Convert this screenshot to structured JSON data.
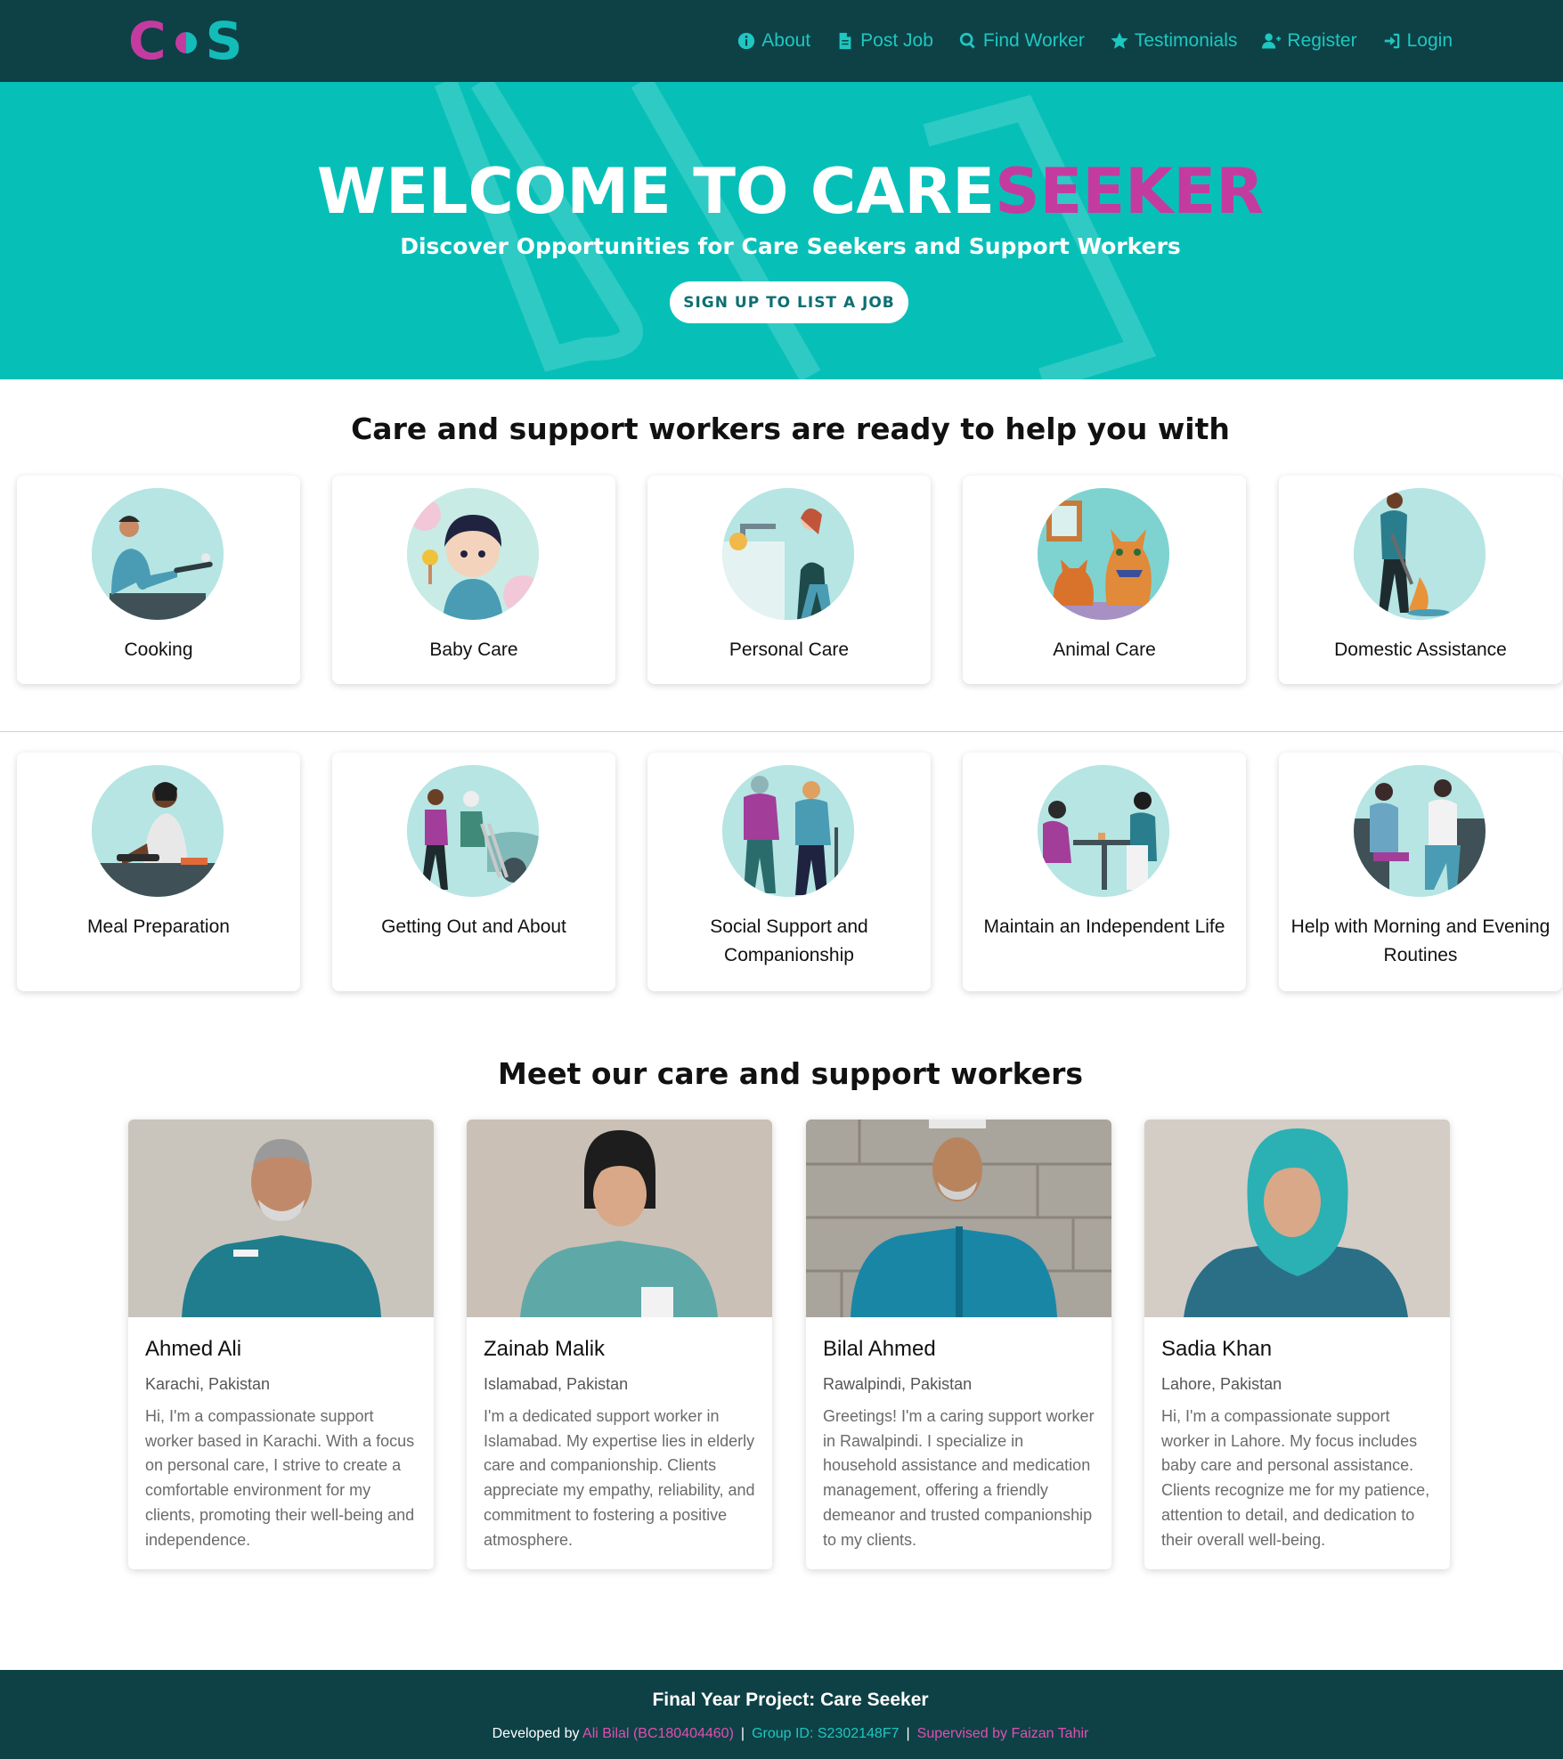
{
  "brand": {
    "logo_left": "C",
    "logo_right": "S",
    "colors": {
      "navbar": "#0d4146",
      "hero": "#06c0b8",
      "accent_pink": "#c43ba0",
      "accent_teal": "#1ec7c1"
    }
  },
  "nav": {
    "items": [
      {
        "label": "About",
        "icon": "info-circle-icon"
      },
      {
        "label": "Post Job",
        "icon": "file-icon"
      },
      {
        "label": "Find Worker",
        "icon": "search-icon"
      },
      {
        "label": "Testimonials",
        "icon": "star-icon"
      },
      {
        "label": "Register",
        "icon": "user-plus-icon"
      },
      {
        "label": "Login",
        "icon": "sign-in-icon"
      }
    ]
  },
  "hero": {
    "title_main": "WELCOME TO CARE",
    "title_accent": "SEEKER",
    "subtitle": "Discover Opportunities for Care Seekers and Support Workers",
    "cta_label": "SIGN UP TO LIST A JOB"
  },
  "services": {
    "heading": "Care and support workers are ready to help you with",
    "items": [
      {
        "label": "Cooking"
      },
      {
        "label": "Baby Care"
      },
      {
        "label": "Personal Care"
      },
      {
        "label": "Animal Care"
      },
      {
        "label": "Domestic Assistance"
      },
      {
        "label": "Meal Preparation"
      },
      {
        "label": "Getting Out and About"
      },
      {
        "label": "Social Support and Companionship"
      },
      {
        "label": "Maintain an Independent Life"
      },
      {
        "label": "Help with Morning and Evening Routines"
      }
    ]
  },
  "workers": {
    "heading": "Meet our care and support workers",
    "items": [
      {
        "name": "Ahmed Ali",
        "location": "Karachi, Pakistan",
        "bio": "Hi, I'm a compassionate support worker based in Karachi. With a focus on personal care, I strive to create a comfortable environment for my clients, promoting their well-being and independence."
      },
      {
        "name": "Zainab Malik",
        "location": "Islamabad, Pakistan",
        "bio": "I'm a dedicated support worker in Islamabad. My expertise lies in elderly care and companionship. Clients appreciate my empathy, reliability, and commitment to fostering a positive atmosphere."
      },
      {
        "name": "Bilal Ahmed",
        "location": "Rawalpindi, Pakistan",
        "bio": "Greetings! I'm a caring support worker in Rawalpindi. I specialize in household assistance and medication management, offering a friendly demeanor and trusted companionship to my clients."
      },
      {
        "name": "Sadia Khan",
        "location": "Lahore, Pakistan",
        "bio": "Hi, I'm a compassionate support worker in Lahore. My focus includes baby care and personal assistance. Clients recognize me for my patience, attention to detail, and dedication to their overall well-being."
      }
    ]
  },
  "footer": {
    "title": "Final Year Project: Care Seeker",
    "developed_prefix": "Developed by ",
    "developer": "Ali Bilal (BC180404460)",
    "separator": "|",
    "group": "Group ID: S2302148F7",
    "supervisor": "Supervised by Faizan Tahir"
  }
}
